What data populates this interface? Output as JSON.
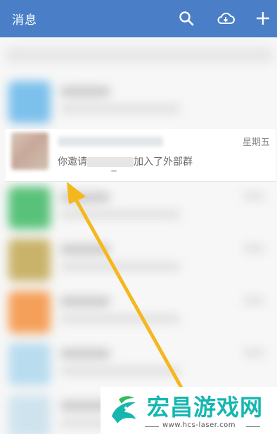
{
  "header": {
    "title": "消息",
    "icons": [
      "search-icon",
      "cloud-icon",
      "plus-icon"
    ]
  },
  "highlighted_item": {
    "day": "星期五",
    "message_prefix": "你邀请",
    "message_suffix": "加入了外部群"
  },
  "watermark": {
    "brand": "宏昌游戏网",
    "url": "www.hcs-laser.com"
  },
  "colors": {
    "header": "#4a7fc7",
    "arrow": "#f5b71e",
    "brand": "#16b6b0"
  }
}
